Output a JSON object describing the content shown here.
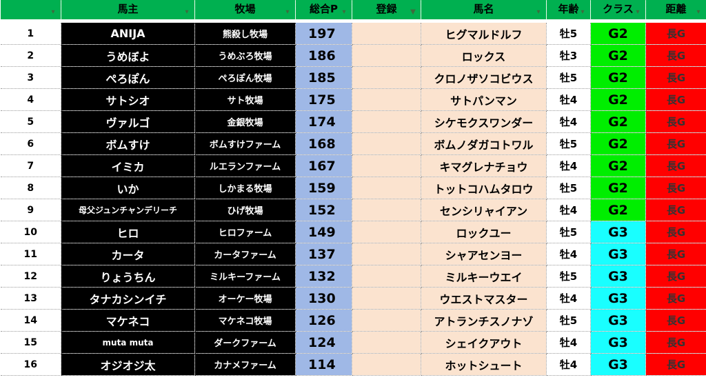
{
  "headers": [
    {
      "label": "",
      "filter": "▾"
    },
    {
      "label": "馬主",
      "filter": "▾"
    },
    {
      "label": "牧場",
      "filter": "▾"
    },
    {
      "label": "総合P",
      "filter": "▾"
    },
    {
      "label": "登録",
      "filter": "▼"
    },
    {
      "label": "馬名",
      "filter": "▾"
    },
    {
      "label": "年齢",
      "filter": "▾"
    },
    {
      "label": "クラス",
      "filter": "▾"
    },
    {
      "label": "距離",
      "filter": "▾"
    }
  ],
  "rows": [
    {
      "no": "1",
      "owner": "ANIJA",
      "ranch": "熊殺し牧場",
      "points": "197",
      "registered": "",
      "horse": "ヒグマルドルフ",
      "age": "牡5",
      "class": "G2",
      "distance": "長G"
    },
    {
      "no": "2",
      "owner": "うめぼよ",
      "ranch": "うめぶろ牧場",
      "points": "186",
      "registered": "",
      "horse": "ロックス",
      "age": "牡3",
      "class": "G2",
      "distance": "長G"
    },
    {
      "no": "3",
      "owner": "ぺろぽん",
      "ranch": "ぺろぽん牧場",
      "points": "185",
      "registered": "",
      "horse": "クロノザソコビウス",
      "age": "牡5",
      "class": "G2",
      "distance": "長G"
    },
    {
      "no": "4",
      "owner": "サトシオ",
      "ranch": "サト牧場",
      "points": "175",
      "registered": "",
      "horse": "サトパンマン",
      "age": "牡4",
      "class": "G2",
      "distance": "長G"
    },
    {
      "no": "5",
      "owner": "ヴァルゴ",
      "ranch": "金銀牧場",
      "points": "174",
      "registered": "",
      "horse": "シケモクスワンダー",
      "age": "牡4",
      "class": "G2",
      "distance": "長G"
    },
    {
      "no": "6",
      "owner": "ボムすけ",
      "ranch": "ボムすけファーム",
      "points": "168",
      "registered": "",
      "horse": "ボムノダガコトワル",
      "age": "牡5",
      "class": "G2",
      "distance": "長G"
    },
    {
      "no": "7",
      "owner": "イミカ",
      "ranch": "ルエランファーム",
      "points": "167",
      "registered": "",
      "horse": "キマグレナチョウ",
      "age": "牡4",
      "class": "G2",
      "distance": "長G"
    },
    {
      "no": "8",
      "owner": "いか",
      "ranch": "しかまる牧場",
      "points": "159",
      "registered": "",
      "horse": "トットコハムタロウ",
      "age": "牡5",
      "class": "G2",
      "distance": "長G"
    },
    {
      "no": "9",
      "owner": "母父ジュンチャンデリーチ",
      "ranch": "ひげ牧場",
      "points": "152",
      "registered": "",
      "horse": "センシリャイアン",
      "age": "牡4",
      "class": "G2",
      "distance": "長G"
    },
    {
      "no": "10",
      "owner": "ヒロ",
      "ranch": "ヒロファーム",
      "points": "149",
      "registered": "",
      "horse": "ロックユー",
      "age": "牡5",
      "class": "G3",
      "distance": "長G"
    },
    {
      "no": "11",
      "owner": "カータ",
      "ranch": "カータファーム",
      "points": "137",
      "registered": "",
      "horse": "シャアセンヨー",
      "age": "牡4",
      "class": "G3",
      "distance": "長G"
    },
    {
      "no": "12",
      "owner": "りょうちん",
      "ranch": "ミルキーファーム",
      "points": "132",
      "registered": "",
      "horse": "ミルキーウエイ",
      "age": "牡5",
      "class": "G3",
      "distance": "長G"
    },
    {
      "no": "13",
      "owner": "タナカシンイチ",
      "ranch": "オーケー牧場",
      "points": "130",
      "registered": "",
      "horse": "ウエストマスター",
      "age": "牡4",
      "class": "G3",
      "distance": "長G"
    },
    {
      "no": "14",
      "owner": "マケネコ",
      "ranch": "マケネコ牧場",
      "points": "126",
      "registered": "",
      "horse": "アトランチスノナゾ",
      "age": "牡5",
      "class": "G3",
      "distance": "長G"
    },
    {
      "no": "15",
      "owner": "muta muta",
      "ranch": "ダークファーム",
      "points": "124",
      "registered": "",
      "horse": "シェイクアウト",
      "age": "牡4",
      "class": "G3",
      "distance": "長G"
    },
    {
      "no": "16",
      "owner": "オジオジ太",
      "ranch": "カナメファーム",
      "points": "114",
      "registered": "",
      "horse": "ホットシュート",
      "age": "牡4",
      "class": "G3",
      "distance": "長G"
    }
  ],
  "colors": {
    "header": "#00b050",
    "owner_bg": "#000000",
    "points_bg": "#9fb8e6",
    "horse_bg": "#fbe3cf",
    "g2": "#00ee00",
    "g3": "#19ffff",
    "distance_bg": "#ff0000"
  }
}
